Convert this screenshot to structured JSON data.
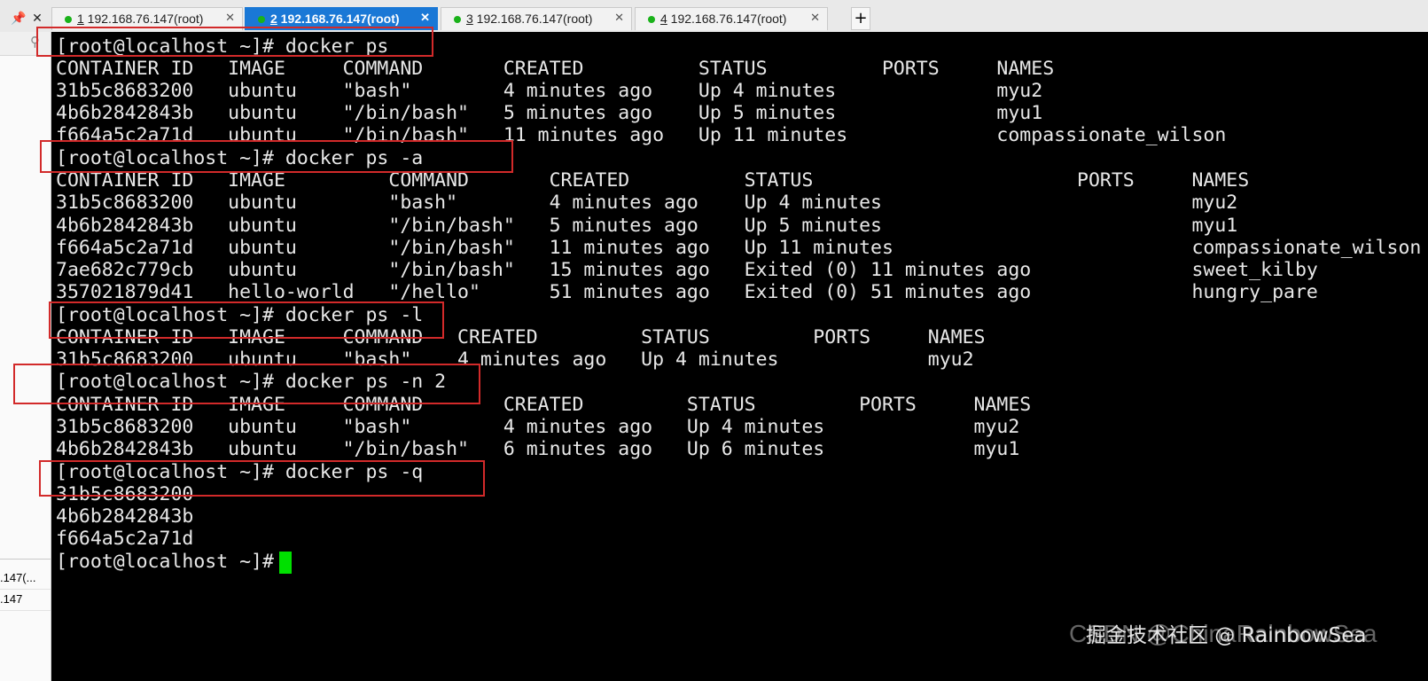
{
  "window_controls": {
    "pin": "📌",
    "close": "✕"
  },
  "tabs": [
    {
      "num": "1",
      "title": " 192.168.76.147(root)",
      "active": false
    },
    {
      "num": "2",
      "title": " 192.168.76.147(root)",
      "active": true
    },
    {
      "num": "3",
      "title": " 192.168.76.147(root)",
      "active": false
    },
    {
      "num": "4",
      "title": " 192.168.76.147(root)",
      "active": false
    }
  ],
  "tab_close": "✕",
  "new_tab_label": "+",
  "sidebar": {
    "search_icon": "search-icon",
    "items": [
      ".147(...",
      ".147"
    ]
  },
  "terminal": {
    "lines": [
      "[root@localhost ~]# docker ps",
      "CONTAINER ID   IMAGE     COMMAND       CREATED          STATUS          PORTS     NAMES",
      "31b5c8683200   ubuntu    \"bash\"        4 minutes ago    Up 4 minutes              myu2",
      "4b6b2842843b   ubuntu    \"/bin/bash\"   5 minutes ago    Up 5 minutes              myu1",
      "f664a5c2a71d   ubuntu    \"/bin/bash\"   11 minutes ago   Up 11 minutes             compassionate_wilson",
      "[root@localhost ~]# docker ps -a",
      "CONTAINER ID   IMAGE         COMMAND       CREATED          STATUS                       PORTS     NAMES",
      "31b5c8683200   ubuntu        \"bash\"        4 minutes ago    Up 4 minutes                           myu2",
      "4b6b2842843b   ubuntu        \"/bin/bash\"   5 minutes ago    Up 5 minutes                           myu1",
      "f664a5c2a71d   ubuntu        \"/bin/bash\"   11 minutes ago   Up 11 minutes                          compassionate_wilson",
      "7ae682c779cb   ubuntu        \"/bin/bash\"   15 minutes ago   Exited (0) 11 minutes ago              sweet_kilby",
      "357021879d41   hello-world   \"/hello\"      51 minutes ago   Exited (0) 51 minutes ago              hungry_pare",
      "[root@localhost ~]# docker ps -l",
      "CONTAINER ID   IMAGE     COMMAND   CREATED         STATUS         PORTS     NAMES",
      "31b5c8683200   ubuntu    \"bash\"    4 minutes ago   Up 4 minutes             myu2",
      "[root@localhost ~]# docker ps -n 2",
      "CONTAINER ID   IMAGE     COMMAND       CREATED         STATUS         PORTS     NAMES",
      "31b5c8683200   ubuntu    \"bash\"        4 minutes ago   Up 4 minutes             myu2",
      "4b6b2842843b   ubuntu    \"/bin/bash\"   6 minutes ago   Up 6 minutes             myu1",
      "[root@localhost ~]# docker ps -q",
      "31b5c8683200",
      "4b6b2842843b",
      "f664a5c2a71d",
      "[root@localhost ~]# "
    ],
    "text_color": "#e8e8e8",
    "background": "#000000",
    "cursor_color": "#00e000",
    "highlight_color": "#d22a2a"
  },
  "watermark": {
    "line1": "CSDN @ChinaRainbowSea",
    "line2": "掘金技术社区 @ RainbowSea"
  }
}
